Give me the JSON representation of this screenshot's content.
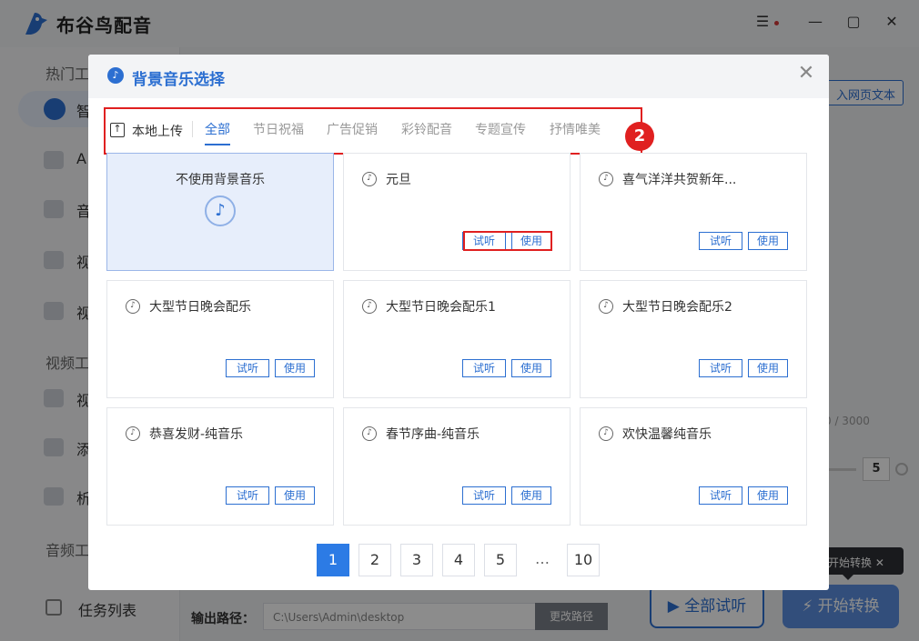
{
  "app": {
    "title": "布谷鸟配音"
  },
  "sidebar": {
    "sections": [
      "热门工",
      "视频工",
      "音频工"
    ],
    "items": [
      {
        "label": "智"
      },
      {
        "label": "A"
      },
      {
        "label": "音"
      },
      {
        "label": "视"
      },
      {
        "label": "视"
      },
      {
        "label": "视"
      },
      {
        "label": "添"
      },
      {
        "label": "析"
      }
    ],
    "task_list": "任务列表"
  },
  "main": {
    "paste_button": "入网页文本",
    "char_count": "0 / 3000",
    "speed_value": "5",
    "output_label": "输出路径：",
    "output_path": "C:\\Users\\Admin\\desktop",
    "change_path": "更改路径",
    "listen_all": "全部试听",
    "start_convert": "开始转换",
    "tooltip": "开始转换"
  },
  "modal": {
    "title": "背景音乐选择",
    "upload_label": "本地上传",
    "tabs": [
      "全部",
      "节日祝福",
      "广告促销",
      "彩铃配音",
      "专题宣传",
      "抒情唯美"
    ],
    "badge": "2",
    "no_music_label": "不使用背景音乐",
    "listen_label": "试听",
    "use_label": "使用",
    "tracks": [
      "元旦",
      "喜气洋洋共贺新年...",
      "大型节日晚会配乐",
      "大型节日晚会配乐1",
      "大型节日晚会配乐2",
      "恭喜发财-纯音乐",
      "春节序曲-纯音乐",
      "欢快温馨纯音乐"
    ],
    "pagination": [
      "1",
      "2",
      "3",
      "4",
      "5",
      "…",
      "10"
    ],
    "current_page": "1"
  },
  "colors": {
    "accent": "#2c6fd1",
    "highlight": "#e02020"
  }
}
